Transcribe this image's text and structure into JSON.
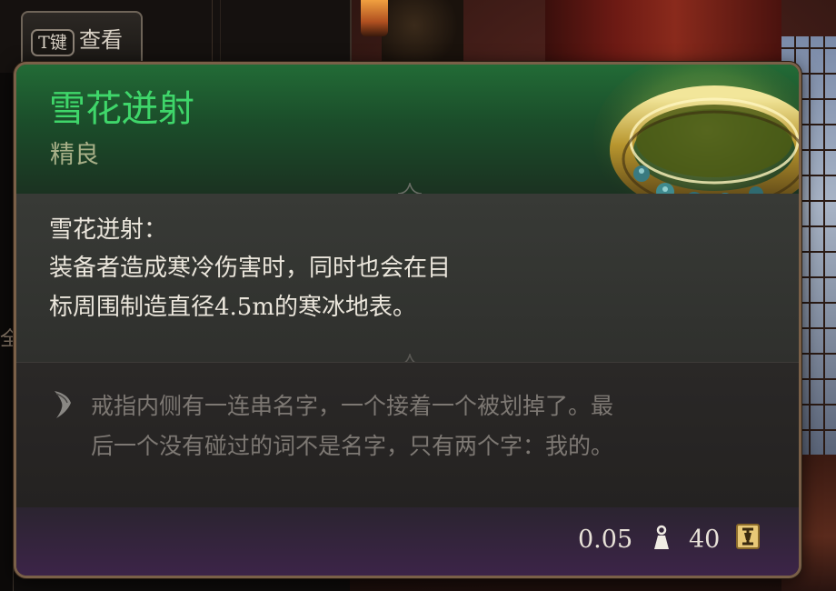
{
  "view_button": {
    "key": "T键",
    "label": "查看"
  },
  "item": {
    "name": "雪花迸射",
    "rarity": "精良",
    "rarity_color": "#3fd66a",
    "description": {
      "title": "雪花迸射：",
      "lines": [
        "装备者造成寒冷伤害时，同时也会在目",
        "标周围制造直径4.5m的寒冰地表。"
      ]
    },
    "lore": {
      "icon": "quill-icon",
      "lines": [
        "戒指内侧有一连串名字，一个接着一个被划掉了。最",
        "后一个没有碰过的词不是名字，只有两个字：我的。"
      ]
    },
    "weight": "0.05",
    "weight_icon": "weight-icon",
    "price": "40",
    "price_icon": "gold-coin-icon"
  },
  "background": {
    "edge_glyph": "全"
  }
}
